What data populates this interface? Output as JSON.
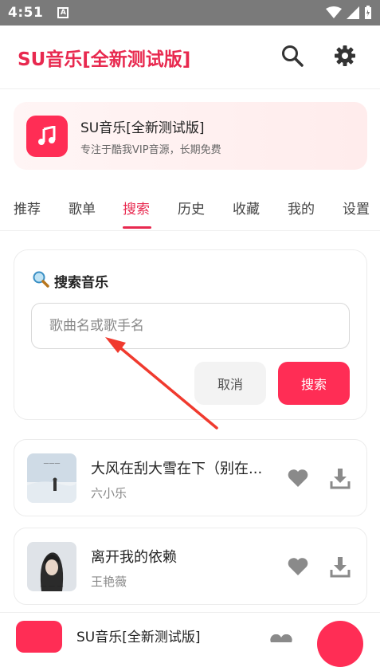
{
  "status": {
    "time": "4:51",
    "a_badge": "A"
  },
  "appbar": {
    "title": "SU音乐[全新测试版]",
    "search_icon": "search-icon",
    "settings_icon": "gear-icon"
  },
  "banner": {
    "name": "SU音乐[全新测试版]",
    "desc": "专注于酷我VIP音源，长期免费"
  },
  "tabs": [
    {
      "label": "推荐"
    },
    {
      "label": "歌单"
    },
    {
      "label": "搜索"
    },
    {
      "label": "历史"
    },
    {
      "label": "收藏"
    },
    {
      "label": "我的"
    },
    {
      "label": "设置"
    }
  ],
  "active_tab": "搜索",
  "search": {
    "heading": "搜索音乐",
    "placeholder": "歌曲名或歌手名",
    "cancel_label": "取消",
    "search_label": "搜索"
  },
  "songs": [
    {
      "title": "大风在刮大雪在下（别在...",
      "artist": "六小乐"
    },
    {
      "title": "离开我的依赖",
      "artist": "王艳薇"
    }
  ],
  "player": {
    "title": "SU音乐[全新测试版]"
  },
  "colors": {
    "accent": "#e8294f",
    "button": "#ff2d55"
  }
}
